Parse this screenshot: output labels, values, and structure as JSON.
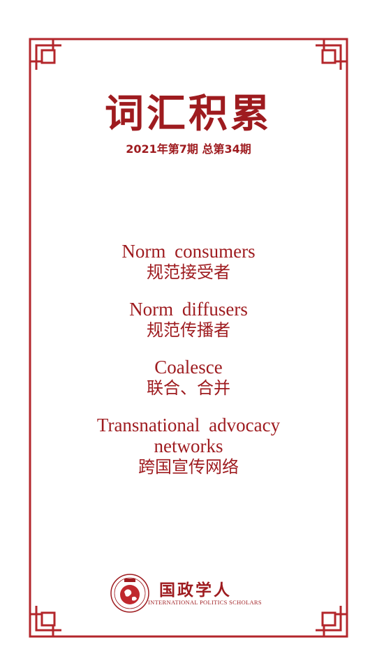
{
  "header": {
    "title": "词汇积累",
    "issue": "2021年第7期  总第34期"
  },
  "terms": [
    {
      "en": "Norm consumers",
      "zh": "规范接受者"
    },
    {
      "en": "Norm diffusers",
      "zh": "规范传播者"
    },
    {
      "en": "Coalesce",
      "zh": "联合、合并"
    },
    {
      "en_line1": "Transnational advocacy",
      "en_line2": "networks",
      "zh": "跨国宣传网络"
    }
  ],
  "footer": {
    "logo_cn": "国政学人",
    "logo_en": "INTERNATIONAL POLITICS SCHOLARS"
  },
  "colors": {
    "accent": "#9e1b1f",
    "background": "#ffffff"
  }
}
